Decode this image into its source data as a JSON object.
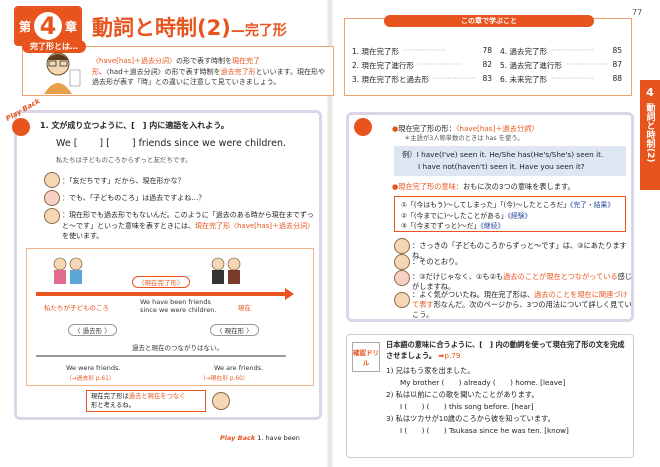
{
  "header": {
    "chapter_pre": "第",
    "chapter_num": "4",
    "chapter_post": "章",
    "title": "動詞と時制",
    "title_num": "(2)",
    "subtitle": "—完了形",
    "page_number": "77"
  },
  "definition": {
    "label": "完了形とは…",
    "text_1": "〈have[has]＋過去分詞〉",
    "text_2": "の形で表す時制を",
    "text_3": "現在完了形",
    "text_4": "、〈had＋過去分詞〉",
    "text_5": "の形で表す時制を",
    "text_6": "過去完了形",
    "text_7": "といいます。現在形や過去形が表す「時」との違いに注意して見ていきましょう。"
  },
  "lessons": {
    "heading": "この章で学ぶこと",
    "items": [
      {
        "label": "1. 現在完了形",
        "page": "78"
      },
      {
        "label": "2. 現在完了進行形",
        "page": "82"
      },
      {
        "label": "3. 現在完了形と過去形",
        "page": "83"
      },
      {
        "label": "4. 過去完了形",
        "page": "85"
      },
      {
        "label": "5. 過去完了進行形",
        "page": "87"
      },
      {
        "label": "6. 未来完了形",
        "page": "88"
      }
    ]
  },
  "side_tab": {
    "num": "4",
    "text": "動詞と時制",
    "sub": "(2)"
  },
  "left": {
    "playback": "Play Back",
    "q_title": "1. 文が成り立つように、[　] 内に適語を入れよう。",
    "sentence_pre": "We [",
    "sentence_mid": "] [",
    "sentence_post": "] friends since we were children.",
    "translation": "私たちは子どものころからずっと友だちです。",
    "dlg1": "：「友だちです」だから、現在形かな？",
    "dlg2": "：でも、「子どものころ」は過去ですよね…？",
    "dlg3a": "：現在形でも過去形でもないんだ。このように「過去のある時から現在までずっと〜です」といった意味を表すときには、",
    "dlg3b": "現在完了形〈have[has]＋過去分詞〉",
    "dlg3c": "を使います。",
    "d_present_perfect": "〈現在完了形〉",
    "d_childhood": "私たちが子どものころ",
    "d_we_have_been": "We have been friends",
    "d_since": "since we were children.",
    "d_now": "現在",
    "d_past": "〈 過去形 〉",
    "d_present": "〈 現在形 〉",
    "d_note": "過去と現在のつながりはない。",
    "d_we_were": "We were friends.",
    "d_we_were_note": "（→過去形 p.61）",
    "d_we_are": "We are friends.",
    "d_we_are_note": "（→現在形 p.60）",
    "memo_1": "現在完了形は",
    "memo_2": "過去と現在をつなぐ",
    "memo_3": "形と考えるね。",
    "answer_label": "Play Back",
    "answer": "1. have been"
  },
  "right": {
    "r1a": "現在完了形の形：",
    "r1b": "〈have[has]＋過去分詞〉",
    "r1c": "＊主語が3人称単数のときは has を使う。",
    "ex1": "例）I have(I've) seen it.   He/She has(He's/She's) seen it.",
    "ex2": "I have not(haven't) seen it.   Have you seen it?",
    "r2a": "現在完了形の意味：",
    "r2b": "おもに次の3つの意味を表します。",
    "u1": "①「(今はもう)〜してしまった」「(今)〜したところだ」",
    "u1b": "《完了・結果》",
    "u2": "②「(今までに)〜したことがある」",
    "u2b": "《経験》",
    "u3": "③「(今までずっと)〜だ」",
    "u3b": "《継続》",
    "dl1": "：さっきの「子どものころからずっと〜です」は、③にあたりますね。",
    "dl2": "：そのとおり。",
    "dl3a": "：③だけじゃなく、①も②も",
    "dl3b": "過去のことが現在とつながっている",
    "dl3c": "感じがしますね。",
    "dl4a": "：よく気がついたね。現在完了形は、",
    "dl4b": "過去のことを現在に関連づけて表す",
    "dl4c": "形なんだ。次のページから、3つの用法について詳しく見ていこう。",
    "drill_tag": "確認ドリル",
    "drill_q": "日本語の意味に合うように、[　] 内の動詞を使って現在完了形の文を完成させましょう。",
    "drill_ref": "➡p.79",
    "d1j": "1) 兄はもう家を出ました。",
    "d1e": "My brother (　　) already (　　) home.  [leave]",
    "d2j": "2) 私は以前にこの歌を聞いたことがあります。",
    "d2e": "I (　　) (　　) this song before.  [hear]",
    "d3j": "3) 私はツカサが10歳のころから彼を知っています。",
    "d3e": "I (　　) (　　) Tsukasa since he was ten.  [know]"
  }
}
